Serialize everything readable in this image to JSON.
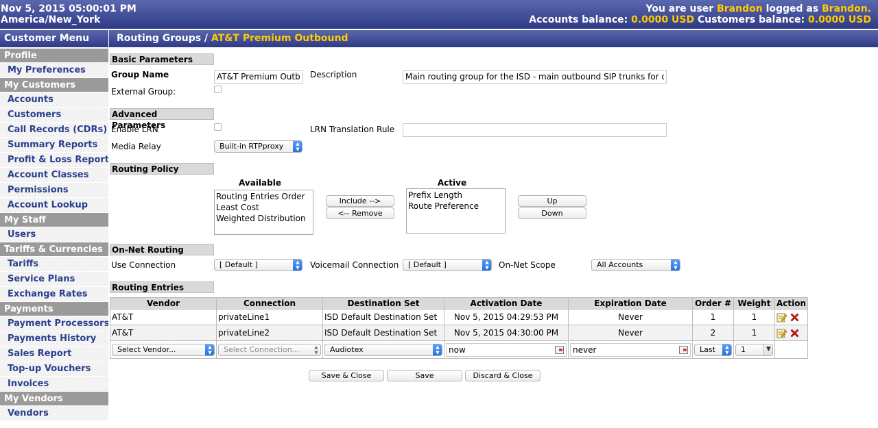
{
  "header": {
    "datetime": "Nov 5, 2015 05:00:01 PM",
    "timezone": "America/New_York",
    "user_prefix": "You are user",
    "user_name": "Brandon",
    "logged_as_label": "logged as",
    "logged_as": "Brandon.",
    "accounts_balance_label": "Accounts balance:",
    "accounts_balance": "0.0000 USD",
    "customers_balance_label": "Customers balance:",
    "customers_balance": "0.0000 USD",
    "accent_color": "#ffcc00"
  },
  "sidebar": {
    "title": "Customer Menu",
    "sections": [
      {
        "label": "Profile",
        "items": [
          "My Preferences"
        ]
      },
      {
        "label": "My Customers",
        "items": [
          "Accounts",
          "Customers",
          "Call Records (CDRs)",
          "Summary Reports",
          "Profit & Loss Report",
          "Account Classes",
          "Permissions",
          "Account Lookup"
        ]
      },
      {
        "label": "My Staff",
        "items": [
          "Users"
        ]
      },
      {
        "label": "Tariffs & Currencies",
        "items": [
          "Tariffs",
          "Service Plans",
          "Exchange Rates"
        ]
      },
      {
        "label": "Payments",
        "items": [
          "Payment Processors",
          "Payments History",
          "Sales Report",
          "Top-up Vouchers",
          "Invoices"
        ]
      },
      {
        "label": "My Vendors",
        "items": [
          "Vendors"
        ]
      }
    ]
  },
  "page": {
    "title_prefix": "Routing Groups /",
    "title_name": "AT&T Premium Outbound"
  },
  "basic": {
    "header": "Basic Parameters",
    "group_name_label": "Group Name",
    "group_name_value": "AT&T Premium Outbound",
    "description_label": "Description",
    "description_value": "Main routing group for the ISD - main outbound SIP trunks for outbound",
    "external_group_label": "External Group:"
  },
  "advanced": {
    "header": "Advanced Parameters",
    "enable_lrn_label": "Enable LRN",
    "lrn_rule_label": "LRN Translation Rule",
    "lrn_rule_value": "",
    "media_relay_label": "Media Relay",
    "media_relay_value": "Built-in RTPproxy"
  },
  "policy": {
    "header": "Routing Policy",
    "available_label": "Available",
    "available": [
      "Routing Entries Order",
      "Least Cost",
      "Weighted Distribution"
    ],
    "active_label": "Active",
    "active": [
      "Prefix Length",
      "Route Preference"
    ],
    "include_btn": "Include -->",
    "remove_btn": "<-- Remove",
    "up_btn": "Up",
    "down_btn": "Down"
  },
  "onnet": {
    "header": "On-Net Routing",
    "use_connection_label": "Use Connection",
    "use_connection_value": "[ Default ]",
    "voicemail_label": "Voicemail Connection",
    "voicemail_value": "[ Default ]",
    "scope_label": "On-Net Scope",
    "scope_value": "All Accounts"
  },
  "entries": {
    "header": "Routing Entries",
    "columns": [
      "Vendor",
      "Connection",
      "Destination Set",
      "Activation Date",
      "Expiration Date",
      "Order #",
      "Weight",
      "Action"
    ],
    "rows": [
      {
        "vendor": "AT&T",
        "connection": "privateLine1",
        "destination": "ISD Default Destination Set",
        "activation": "Nov 5, 2015 04:29:53 PM",
        "expiration": "Never",
        "order": "1",
        "weight": "1"
      },
      {
        "vendor": "AT&T",
        "connection": "privateLine2",
        "destination": "ISD Default Destination Set",
        "activation": "Nov 5, 2015 04:30:00 PM",
        "expiration": "Never",
        "order": "2",
        "weight": "1"
      }
    ],
    "new_row": {
      "vendor": "Select Vendor...",
      "connection": "Select Connection...",
      "destination": "Audiotex",
      "activation": "now",
      "expiration": "never",
      "order": "Last",
      "weight": "1"
    }
  },
  "footer": {
    "save_close": "Save & Close",
    "save": "Save",
    "discard_close": "Discard & Close"
  }
}
